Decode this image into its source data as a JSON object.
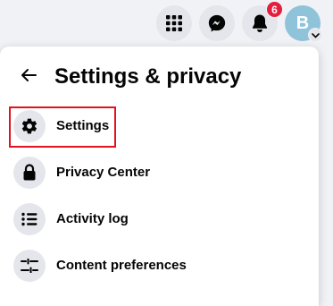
{
  "topbar": {
    "menu_icon": "grid-menu-icon",
    "messenger_icon": "messenger-icon",
    "notifications_icon": "bell-icon",
    "notification_count": "6",
    "avatar_initial": "B",
    "avatar_color": "#8fc3d9",
    "badge_color": "#e41e3f"
  },
  "panel": {
    "back_icon": "arrow-left-icon",
    "title": "Settings & privacy",
    "items": [
      {
        "label": "Settings",
        "icon": "gear-icon",
        "highlighted": true
      },
      {
        "label": "Privacy Center",
        "icon": "lock-icon"
      },
      {
        "label": "Activity log",
        "icon": "list-icon"
      },
      {
        "label": "Content preferences",
        "icon": "sliders-icon"
      }
    ],
    "highlight_color": "#e0141e"
  }
}
